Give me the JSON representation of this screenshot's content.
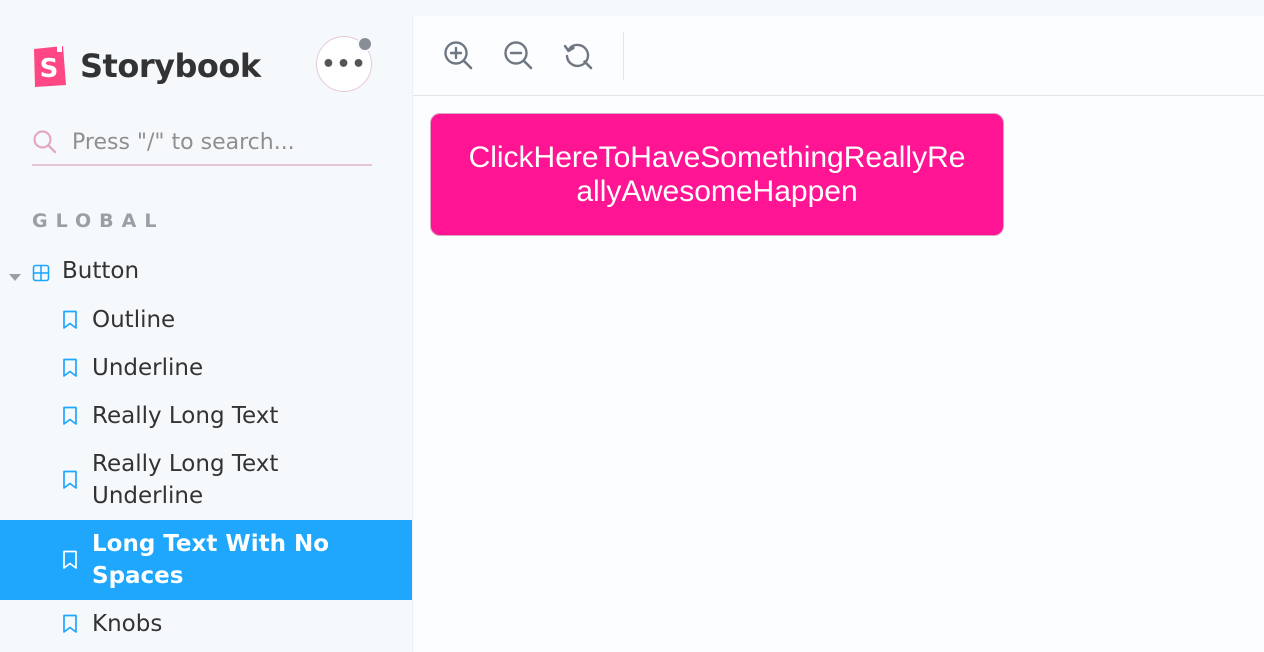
{
  "brand": {
    "name": "Storybook",
    "logo_letter": "S"
  },
  "menu": {
    "label": "•••"
  },
  "search": {
    "placeholder": "Press \"/\" to search..."
  },
  "sidebar": {
    "section": "GLOBAL",
    "component": "Button",
    "stories": [
      {
        "label": "Outline"
      },
      {
        "label": "Underline"
      },
      {
        "label": "Really Long Text"
      },
      {
        "label": "Really Long Text Underline"
      },
      {
        "label": "Long Text With No Spaces",
        "selected": true
      },
      {
        "label": "Knobs"
      }
    ]
  },
  "toolbar": {
    "zoom_in": "zoom-in",
    "zoom_out": "zoom-out",
    "zoom_reset": "zoom-reset"
  },
  "preview": {
    "button_text": "ClickHereToHaveSomethingReallyReallyAwesomeHappen"
  },
  "colors": {
    "accent": "#1EA7FD",
    "brand_pink": "#FF4785",
    "demo_button": "#FF1493"
  }
}
